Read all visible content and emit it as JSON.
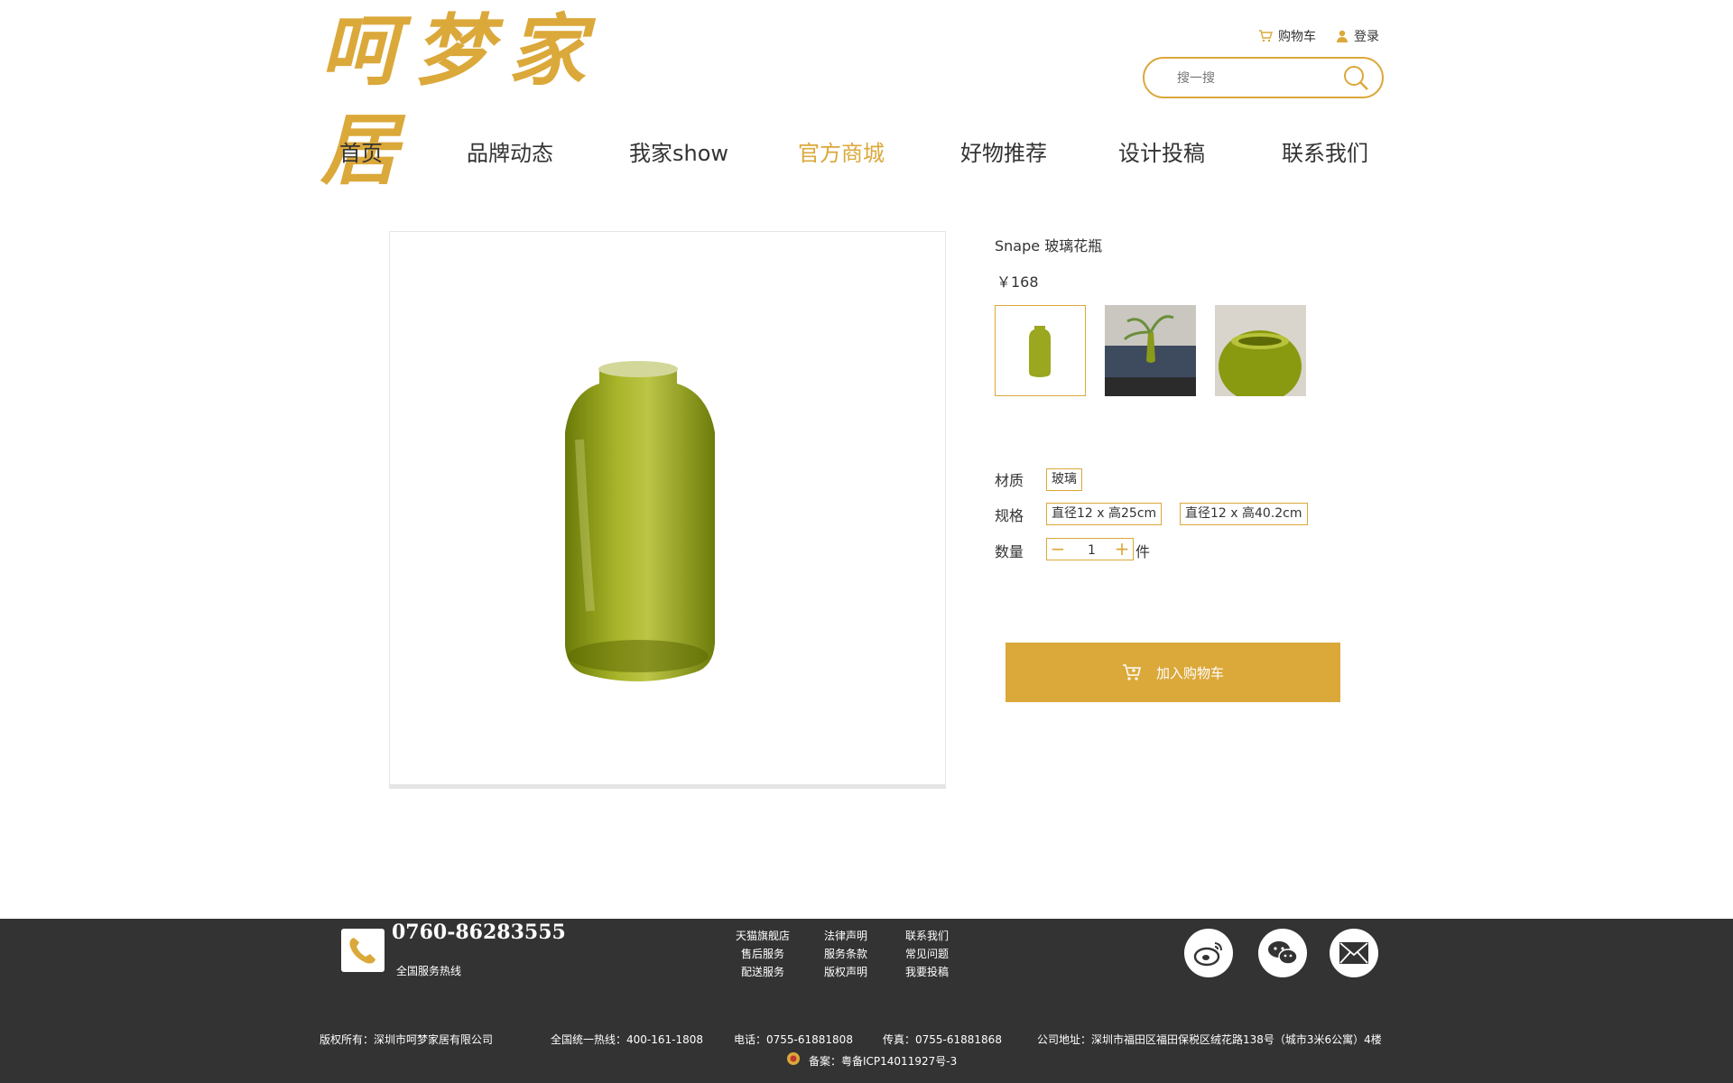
{
  "header": {
    "logo_text": "呵梦家居",
    "cart_label": "购物车",
    "login_label": "登录",
    "search_placeholder": "搜一搜"
  },
  "nav": {
    "items": [
      {
        "label": "首页"
      },
      {
        "label": "品牌动态"
      },
      {
        "label": "我家show"
      },
      {
        "label": "官方商城",
        "active": true
      },
      {
        "label": "好物推荐"
      },
      {
        "label": "设计投稿"
      },
      {
        "label": "联系我们"
      }
    ]
  },
  "product": {
    "name": "Snape 玻璃花瓶",
    "price": "￥168",
    "material_label": "材质",
    "material_options": [
      "玻璃"
    ],
    "spec_label": "规格",
    "spec_options": [
      "直径12 x 高25cm",
      "直径12 x 高40.2cm"
    ],
    "quantity_label": "数量",
    "quantity_value": "1",
    "quantity_unit": "件",
    "add_to_cart_label": "加入购物车",
    "vase_color": "#8a9a1a"
  },
  "footer": {
    "hotline_number": "0760-86283555",
    "hotline_label": "全国服务热线",
    "links": [
      [
        "天猫旗舰店",
        "法律声明",
        "联系我们"
      ],
      [
        "售后服务",
        "服务条款",
        "常见问题"
      ],
      [
        "配送服务",
        "版权声明",
        "我要投稿"
      ]
    ],
    "copyright": "版权所有：深圳市呵梦家居有限公司",
    "national_hotline": "全国统一热线：400-161-1808",
    "tel": "电话：0755-61881808",
    "fax": "传真：0755-61881868",
    "address": "公司地址：深圳市福田区福田保税区绒花路138号（城市3米6公寓）4楼",
    "icp": "备案：粤备ICP14011927号-3"
  },
  "colors": {
    "accent": "#dba83a",
    "footer_bg": "#333333"
  }
}
